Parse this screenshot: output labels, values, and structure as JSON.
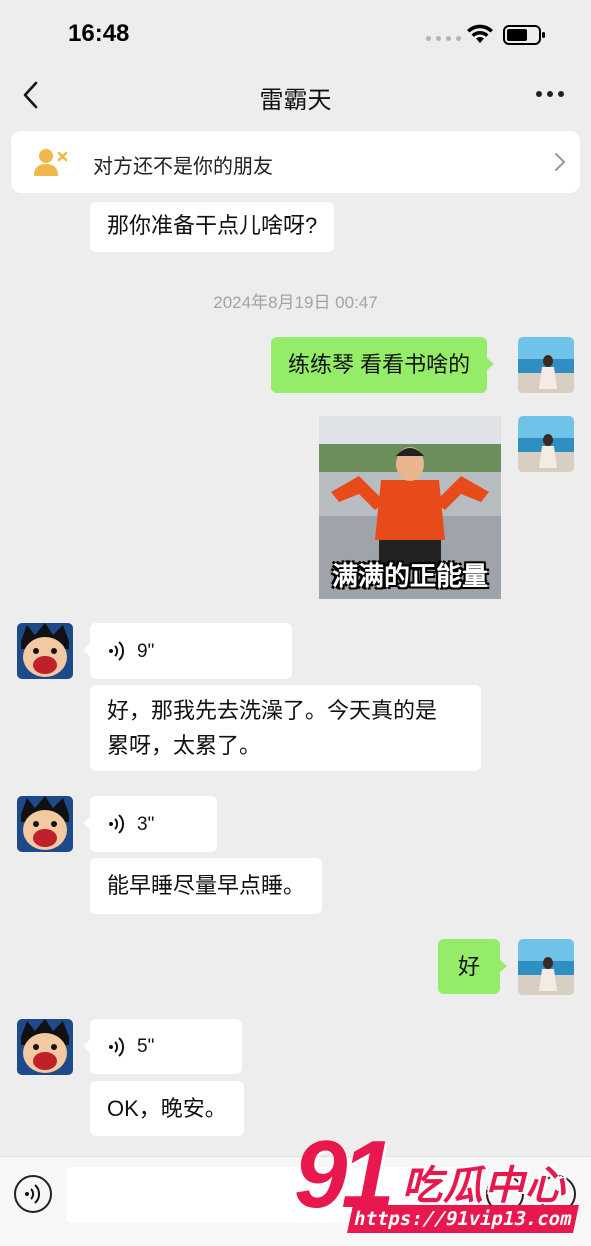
{
  "status_bar": {
    "time": "16:48"
  },
  "nav": {
    "title": "雷霸天"
  },
  "notice": {
    "text": "对方还不是你的朋友"
  },
  "timestamp": "2024年8月19日 00:47",
  "messages": [
    {
      "type": "text",
      "side": "left",
      "text": "那你准备干点儿啥呀?"
    },
    {
      "type": "text",
      "side": "right",
      "text": "练练琴 看看书啥的"
    },
    {
      "type": "sticker",
      "side": "right",
      "caption": "满满的正能量"
    },
    {
      "type": "voice",
      "side": "left",
      "duration": "9\""
    },
    {
      "type": "text",
      "side": "left",
      "line1": "好，那我先去洗澡了。今天真的是",
      "line2": "累呀，太累了。"
    },
    {
      "type": "voice",
      "side": "left",
      "duration": "3\""
    },
    {
      "type": "text",
      "side": "left",
      "text": "能早睡尽量早点睡。"
    },
    {
      "type": "text",
      "side": "right",
      "text": "好"
    },
    {
      "type": "voice",
      "side": "left",
      "duration": "5\""
    },
    {
      "type": "text",
      "side": "left",
      "text": "OK，晚安。"
    }
  ],
  "watermark": {
    "number": "91",
    "title": "吃瓜中心",
    "url": "https://91vip13.com"
  },
  "colors": {
    "background": "#ededed",
    "sent_bubble": "#95ec69",
    "received_bubble": "#ffffff",
    "watermark": "#e8174d"
  },
  "icons": [
    "back-icon",
    "more-icon",
    "user-x-icon",
    "chevron-right-icon",
    "voice-wave-icon",
    "voice-toggle-icon",
    "emoji-icon",
    "plus-icon",
    "wifi-icon",
    "battery-icon"
  ]
}
